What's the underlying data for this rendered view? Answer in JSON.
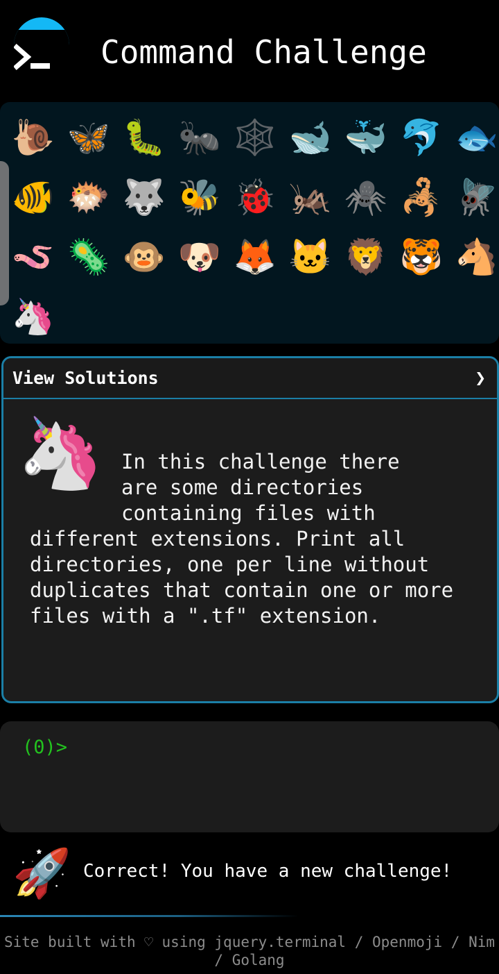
{
  "header": {
    "title": "Command Challenge",
    "logo_icon": "terminal-prompt-icon"
  },
  "animals": [
    {
      "name": "snail",
      "glyph": "🐌"
    },
    {
      "name": "butterfly",
      "glyph": "🦋"
    },
    {
      "name": "caterpillar",
      "glyph": "🐛"
    },
    {
      "name": "ant",
      "glyph": "🐜"
    },
    {
      "name": "spider-web",
      "glyph": "🕸️"
    },
    {
      "name": "whale",
      "glyph": "🐋"
    },
    {
      "name": "spouting-whale",
      "glyph": "🐳"
    },
    {
      "name": "dolphin",
      "glyph": "🐬"
    },
    {
      "name": "fish",
      "glyph": "🐟"
    },
    {
      "name": "tropical-fish",
      "glyph": "🐠"
    },
    {
      "name": "blowfish",
      "glyph": "🐡"
    },
    {
      "name": "wolf",
      "glyph": "🐺"
    },
    {
      "name": "bee",
      "glyph": "🐝"
    },
    {
      "name": "ladybug",
      "glyph": "🐞"
    },
    {
      "name": "cricket",
      "glyph": "🦗"
    },
    {
      "name": "spider",
      "glyph": "🕷️"
    },
    {
      "name": "scorpion",
      "glyph": "🦂"
    },
    {
      "name": "fly",
      "glyph": "🪰"
    },
    {
      "name": "worm",
      "glyph": "🪱"
    },
    {
      "name": "microbe",
      "glyph": "🦠"
    },
    {
      "name": "monkey",
      "glyph": "🐵"
    },
    {
      "name": "dog",
      "glyph": "🐶"
    },
    {
      "name": "fox",
      "glyph": "🦊"
    },
    {
      "name": "cat",
      "glyph": "🐱"
    },
    {
      "name": "lion",
      "glyph": "🦁"
    },
    {
      "name": "tiger",
      "glyph": "🐯"
    },
    {
      "name": "horse",
      "glyph": "🐴"
    },
    {
      "name": "unicorn",
      "glyph": "🦄"
    }
  ],
  "solutions": {
    "label": "View Solutions",
    "chevron": "❯",
    "icon": "unicorn-icon",
    "icon_glyph": "🦄"
  },
  "challenge": {
    "line1": "In this challenge there",
    "line2": "are some directories",
    "line3": "containing files with",
    "rest": "different extensions. Print all directories, one per line without duplicates that contain one or more files with a \".tf\" extension."
  },
  "terminal": {
    "prompt": "(0)>"
  },
  "status": {
    "icon": "rocket-icon",
    "icon_glyph": "🚀",
    "text": "Correct! You have a new challenge!"
  },
  "footer": {
    "text1": "Site built with ♡ using ",
    "link1": "jquery.terminal",
    "sep1": " / ",
    "link2": "Openmoji",
    "sep2": " / ",
    "link3": "Nim",
    "sep3": " / ",
    "link4": "Golang"
  },
  "colors": {
    "accent": "#14b8f5",
    "card_border": "#1b7fa6",
    "prompt": "#23c21f",
    "panel": "#02161f"
  }
}
